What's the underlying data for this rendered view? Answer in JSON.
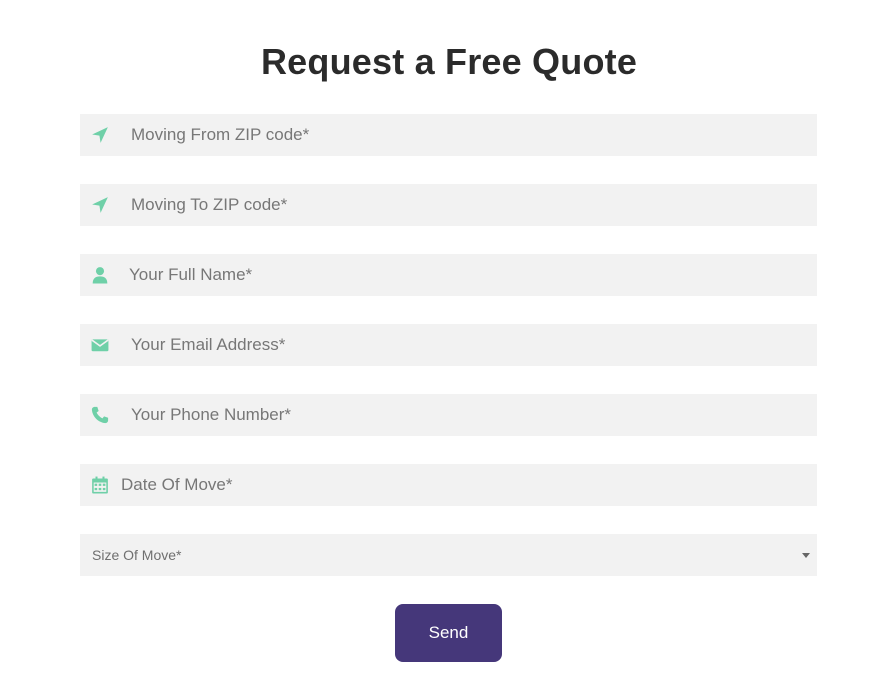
{
  "title": "Request a Free Quote",
  "accent_color": "#6fd0a8",
  "button_color": "#45377a",
  "fields": {
    "moving_from": {
      "placeholder": "Moving From ZIP code*",
      "icon": "location-arrow-icon",
      "value": ""
    },
    "moving_to": {
      "placeholder": "Moving To ZIP code*",
      "icon": "location-arrow-icon",
      "value": ""
    },
    "full_name": {
      "placeholder": "Your Full Name*",
      "icon": "user-icon",
      "value": ""
    },
    "email": {
      "placeholder": "Your Email Address*",
      "icon": "envelope-icon",
      "value": ""
    },
    "phone": {
      "placeholder": "Your Phone Number*",
      "icon": "phone-icon",
      "value": ""
    },
    "date": {
      "placeholder": "Date Of Move*",
      "icon": "calendar-icon",
      "value": ""
    }
  },
  "size_select": {
    "selected": "Size Of Move*",
    "icon": "chevron-down-icon"
  },
  "send_label": "Send"
}
